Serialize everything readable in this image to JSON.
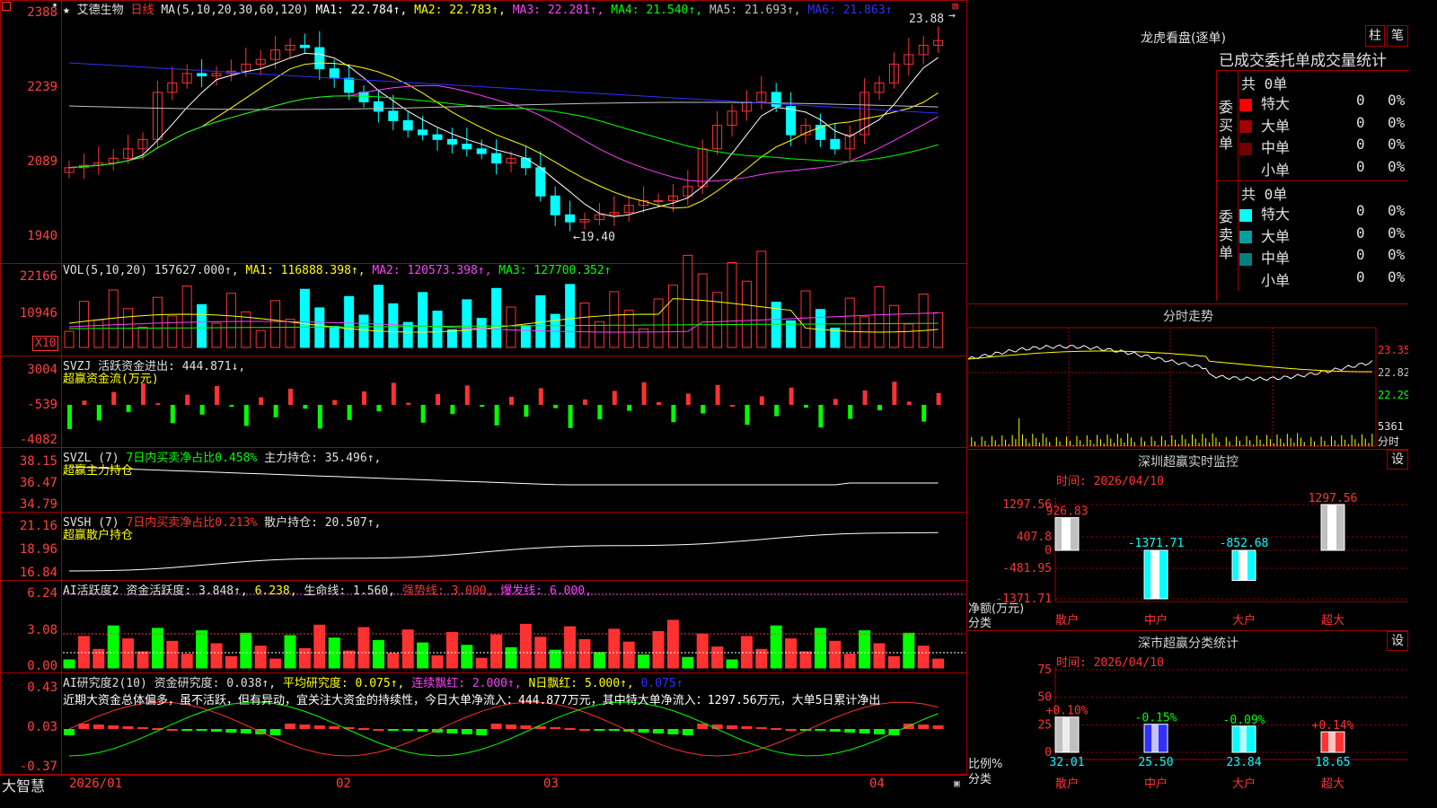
{
  "stock": {
    "name": "艾德生物",
    "period": "日线"
  },
  "main": {
    "ma_label": "MA(5,10,20,30,60,120)",
    "ma": [
      {
        "t": "MA1: 22.784↑,",
        "c": "#ffffff"
      },
      {
        "t": "MA2: 22.783↑,",
        "c": "#ffff00"
      },
      {
        "t": "MA3: 22.281↑,",
        "c": "#ff40ff"
      },
      {
        "t": "MA4: 21.540↑,",
        "c": "#00ff00"
      },
      {
        "t": "MA5: 21.693↑,",
        "c": "#c0c0c0"
      },
      {
        "t": "MA6: 21.863↑",
        "c": "#3030ff"
      }
    ],
    "y_ticks": [
      "2388",
      "2239",
      "2089",
      "1940"
    ],
    "high_label": "23.88",
    "low_label": "←19.40"
  },
  "vol": {
    "label": "VOL(5,10,20)",
    "value": "157627.000↑,",
    "ma": [
      {
        "t": "MA1: 116888.398↑,",
        "c": "#ffff00"
      },
      {
        "t": "MA2: 120573.398↑,",
        "c": "#ff40ff"
      },
      {
        "t": "MA3: 127700.352↑",
        "c": "#00ff00"
      }
    ],
    "y_ticks": [
      "22166",
      "10946"
    ],
    "unit": "X10"
  },
  "svzj": {
    "label": "SVZJ",
    "t1": "活跃资金进出: 444.871↓,",
    "t2": "超赢资金流(万元)",
    "y_ticks": [
      "3004",
      "-539",
      "-4082"
    ]
  },
  "svzl": {
    "label": "SVZL (7)",
    "t1": "7日内买卖净占比0.458%",
    "t2": "主力持仓: 35.496↑,",
    "t3": "超赢主力持仓",
    "y_ticks": [
      "38.15",
      "36.47",
      "34.79"
    ]
  },
  "svsh": {
    "label": "SVSH (7)",
    "t1": "7日内买卖净占比0.213%",
    "t2": "散户持仓: 20.507↑,",
    "t3": "超赢散户持仓",
    "y_ticks": [
      "21.16",
      "18.96",
      "16.84"
    ]
  },
  "ai1": {
    "label": "AI活跃度2",
    "t1": "资金活跃度: 3.848↑,",
    "t2": "6.238,",
    "t3": "生命线: 1.560,",
    "t4": "强势线: 3.000,",
    "t5": "爆发线: 6.000,",
    "y_ticks": [
      "6.24",
      "3.08",
      "0.00"
    ]
  },
  "ai2": {
    "label": "AI研究度2(10)",
    "t1": "资金研究度: 0.038↑,",
    "t2": "平均研究度: 0.075↑,",
    "t3": "连续飘红: 2.000↑,",
    "t4": "N日飘红: 5.000↑,",
    "t5": "0.075↑",
    "desc": "近期大资金总体偏多，虽不活跃，但有异动，宜关注大资金的持续性，今日大单净流入：444.877万元，其中特大单净流入：1297.56万元，大单5日累计净出",
    "y_ticks": [
      "0.43",
      "0.03",
      "-0.37"
    ]
  },
  "dates": [
    "2026/01",
    "02",
    "03",
    "04"
  ],
  "brand": "大智慧",
  "dragon": {
    "title": "龙虎看盘(逐单)",
    "btn1": "柱",
    "btn2": "笔",
    "tabs": "已成交委托单成交量统计",
    "buy": {
      "side": "委买单",
      "total": "共 0单",
      "rows": [
        {
          "n": "特大",
          "v": "0",
          "p": "0%",
          "c": "#ff0000"
        },
        {
          "n": "大单",
          "v": "0",
          "p": "0%",
          "c": "#a00000"
        },
        {
          "n": "中单",
          "v": "0",
          "p": "0%",
          "c": "#700000"
        },
        {
          "n": "小单",
          "v": "0",
          "p": "0%",
          "c": "#000000"
        }
      ]
    },
    "sell": {
      "side": "委卖单",
      "total": "共 0单",
      "rows": [
        {
          "n": "特大",
          "v": "0",
          "p": "0%",
          "c": "#00ffff"
        },
        {
          "n": "大单",
          "v": "0",
          "p": "0%",
          "c": "#00a0a0"
        },
        {
          "n": "中单",
          "v": "0",
          "p": "0%",
          "c": "#008080"
        },
        {
          "n": "小单",
          "v": "0",
          "p": "0%",
          "c": "#000000"
        }
      ]
    }
  },
  "intraday": {
    "title": "分时走势",
    "y_ticks": [
      "23.35",
      "22.82",
      "22.29"
    ],
    "vol": "5361",
    "vol_unit": "分时"
  },
  "sz_monitor": {
    "title": "深圳超赢实时监控",
    "btn": "设",
    "time": "时间: 2026/04/10",
    "y_ticks": [
      "1297.56",
      "407.8",
      "0",
      "-481.95",
      "-1371.71"
    ],
    "ylabel": "净额(万元)",
    "xlabel": "分类",
    "cats": [
      "散户",
      "中户",
      "大户",
      "超大"
    ],
    "values": [
      926.83,
      -1371.71,
      -852.68,
      1297.56
    ],
    "labels": [
      "926.83",
      "-1371.71",
      "-852.68",
      "1297.56"
    ]
  },
  "sz_stat": {
    "title": "深市超赢分类统计",
    "btn": "设",
    "time": "时间: 2026/04/10",
    "y_ticks": [
      "75",
      "50",
      "25",
      "0"
    ],
    "ylabel": "比例%",
    "xlabel": "分类",
    "cats": [
      "散户",
      "中户",
      "大户",
      "超大"
    ],
    "values": [
      32.01,
      25.5,
      23.84,
      18.65
    ],
    "labels": [
      "32.01",
      "25.50",
      "23.84",
      "18.65"
    ],
    "changes": [
      "+0.10%",
      "-0.15%",
      "-0.09%",
      "+0.14%"
    ]
  }
}
